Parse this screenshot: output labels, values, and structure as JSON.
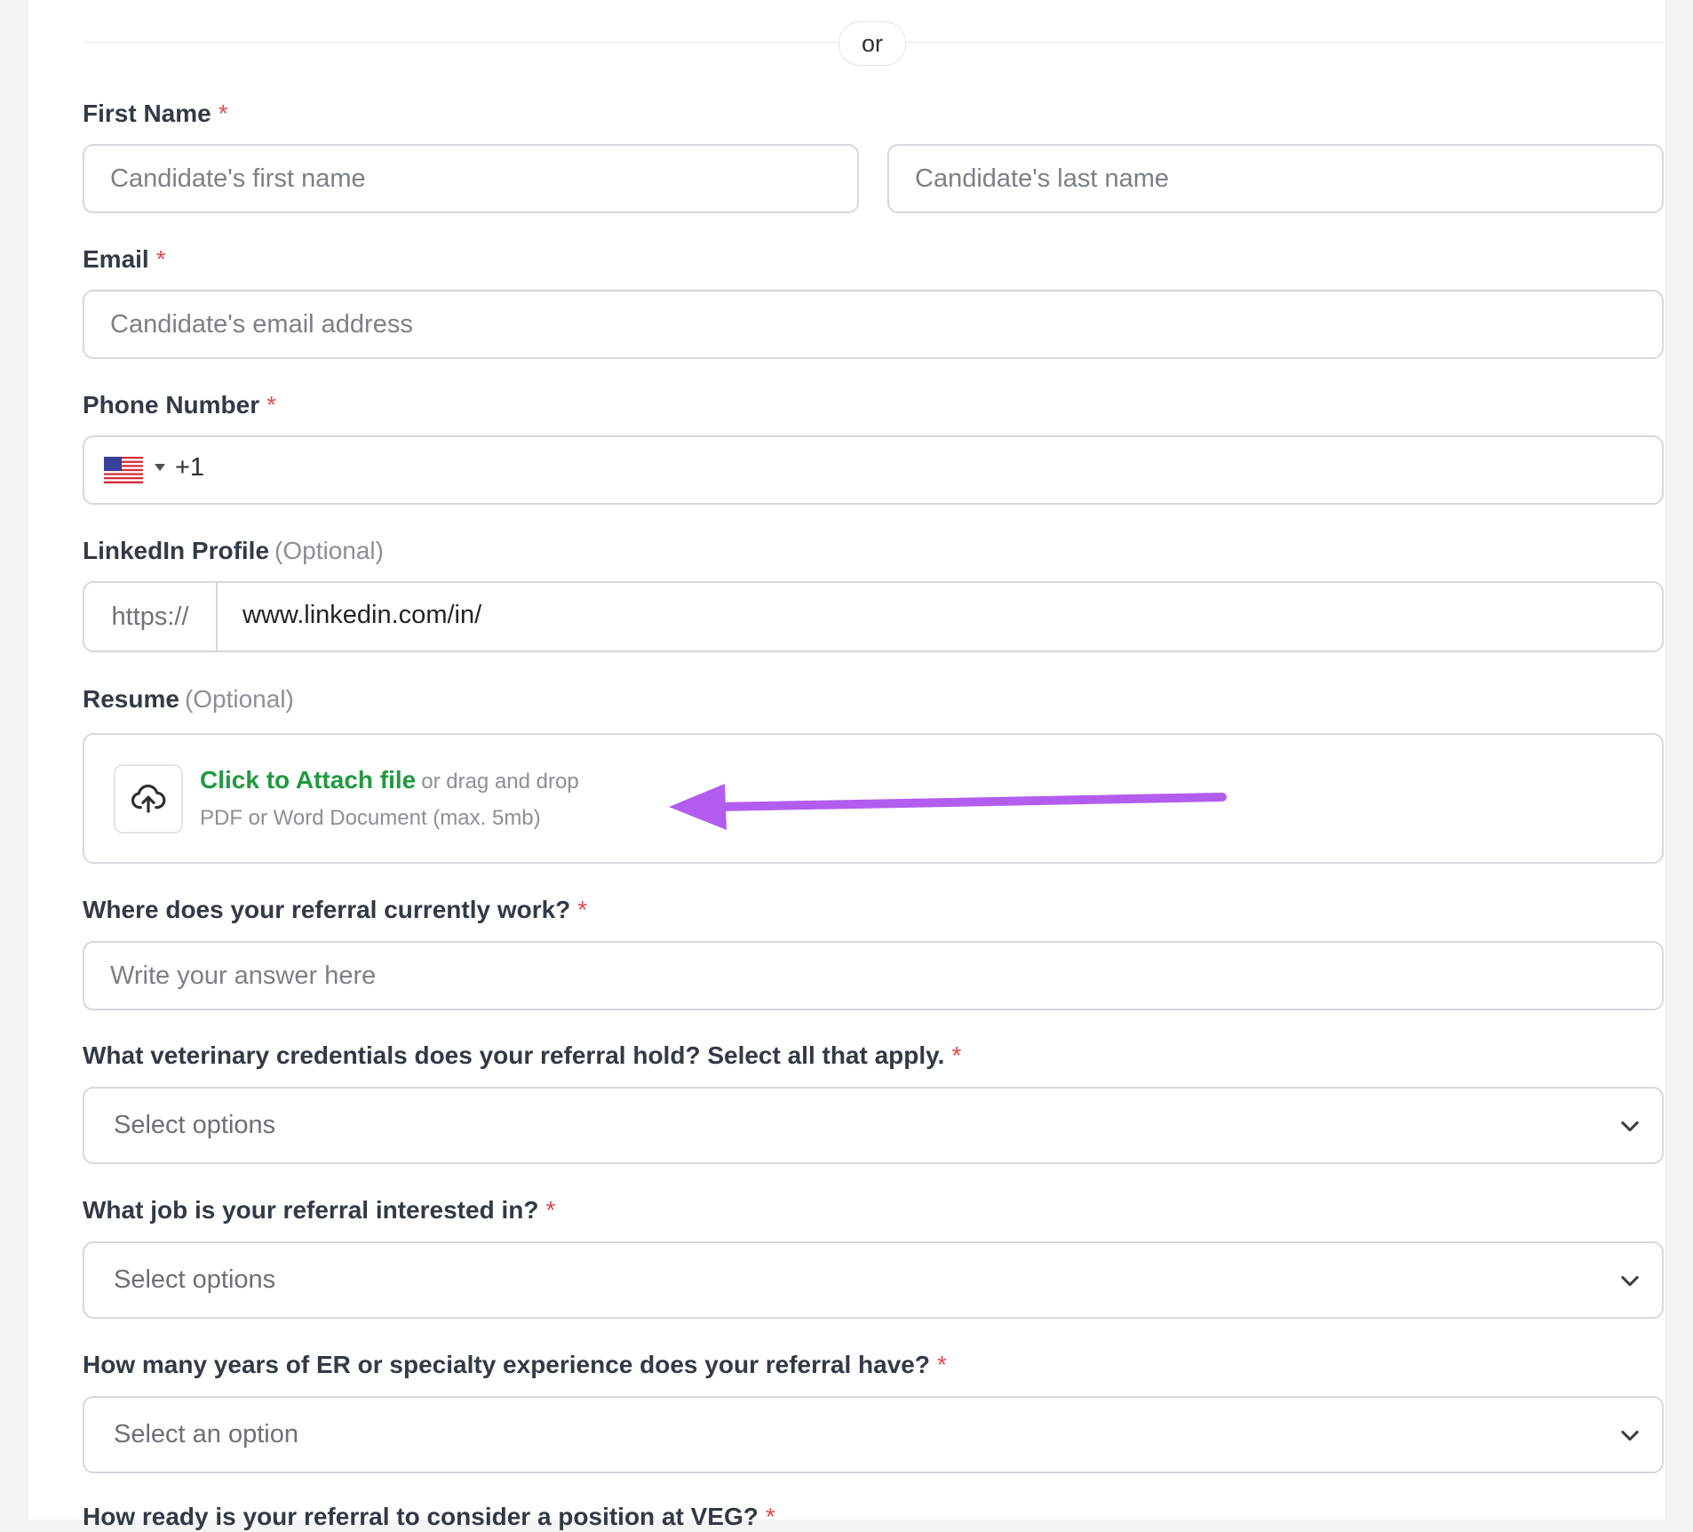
{
  "divider": {
    "text": "or"
  },
  "first_name": {
    "label": "First Name",
    "required": "*",
    "placeholder_first": "Candidate's first name",
    "placeholder_last": "Candidate's last name"
  },
  "email": {
    "label": "Email",
    "required": "*",
    "placeholder": "Candidate's email address"
  },
  "phone": {
    "label": "Phone Number",
    "required": "*",
    "country_icon": "us-flag-icon",
    "dial_code": "+1"
  },
  "linkedin": {
    "label": "LinkedIn Profile",
    "optional": "(Optional)",
    "prefix": "https://",
    "value": "www.linkedin.com/in/"
  },
  "resume": {
    "label": "Resume",
    "optional": "(Optional)",
    "icon": "upload-cloud-icon",
    "link_text": "Click to Attach file",
    "or_text": "or drag and drop",
    "hint": "PDF or Word Document (max. 5mb)"
  },
  "annotation": {
    "arrow_color": "#b25df0"
  },
  "q_work": {
    "label": "Where does your referral currently work?",
    "required": "*",
    "placeholder": "Write your answer here"
  },
  "q_credentials": {
    "label": "What veterinary credentials does your referral hold? Select all that apply.",
    "required": "*",
    "placeholder": "Select options"
  },
  "q_job": {
    "label": "What job is your referral interested in?",
    "required": "*",
    "placeholder": "Select options"
  },
  "q_experience": {
    "label": "How many years of ER or specialty experience does your referral have?",
    "required": "*",
    "placeholder": "Select an option"
  },
  "q_ready": {
    "label": "How ready is your referral to consider a position at VEG?",
    "required": "*"
  },
  "colors": {
    "required": "#e5484d",
    "link": "#1f9a3f",
    "border": "#d5d8dd"
  }
}
